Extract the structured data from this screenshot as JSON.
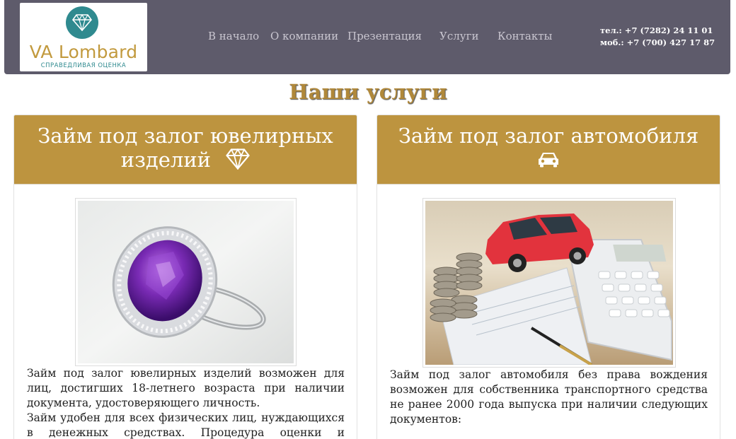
{
  "header": {
    "logo_text": "VA Lombard",
    "logo_subtitle": "СПРАВЕДЛИВАЯ ОЦЕНКА",
    "nav": [
      {
        "label": "В начало"
      },
      {
        "label": "О компании"
      },
      {
        "label": "Презентация"
      },
      {
        "label": "Услуги"
      },
      {
        "label": "Контакты"
      }
    ],
    "phone": "тел.: +7 (7282) 24 11 01",
    "mobile": "моб.: +7 (700) 427 17 87"
  },
  "section_title": "Наши услуги",
  "cards": [
    {
      "title_line1": "Займ под залог ювелирных",
      "title_line2": "изделий",
      "icon": "diamond-icon",
      "paragraph1": "Займ под залог ювелирных изделий возможен для лиц, достигших 18-летнего возраста при наличии документа, удостоверяющего личность.",
      "paragraph2": "Займ удобен для всех физических лиц, нуждающихся в денежных средствах. Процедура оценки и оформления"
    },
    {
      "title_line1": "Займ под залог автомобиля",
      "icon": "car-icon",
      "paragraph1": "Займ под залог автомобиля без права вождения возможен для собственника транспортного средства не ранее 2000 года выпуска при наличии следующих документов:"
    }
  ],
  "colors": {
    "navbar": "#5e5b6b",
    "accent_gold": "#bd943f",
    "logo_teal": "#2f8a8f"
  }
}
